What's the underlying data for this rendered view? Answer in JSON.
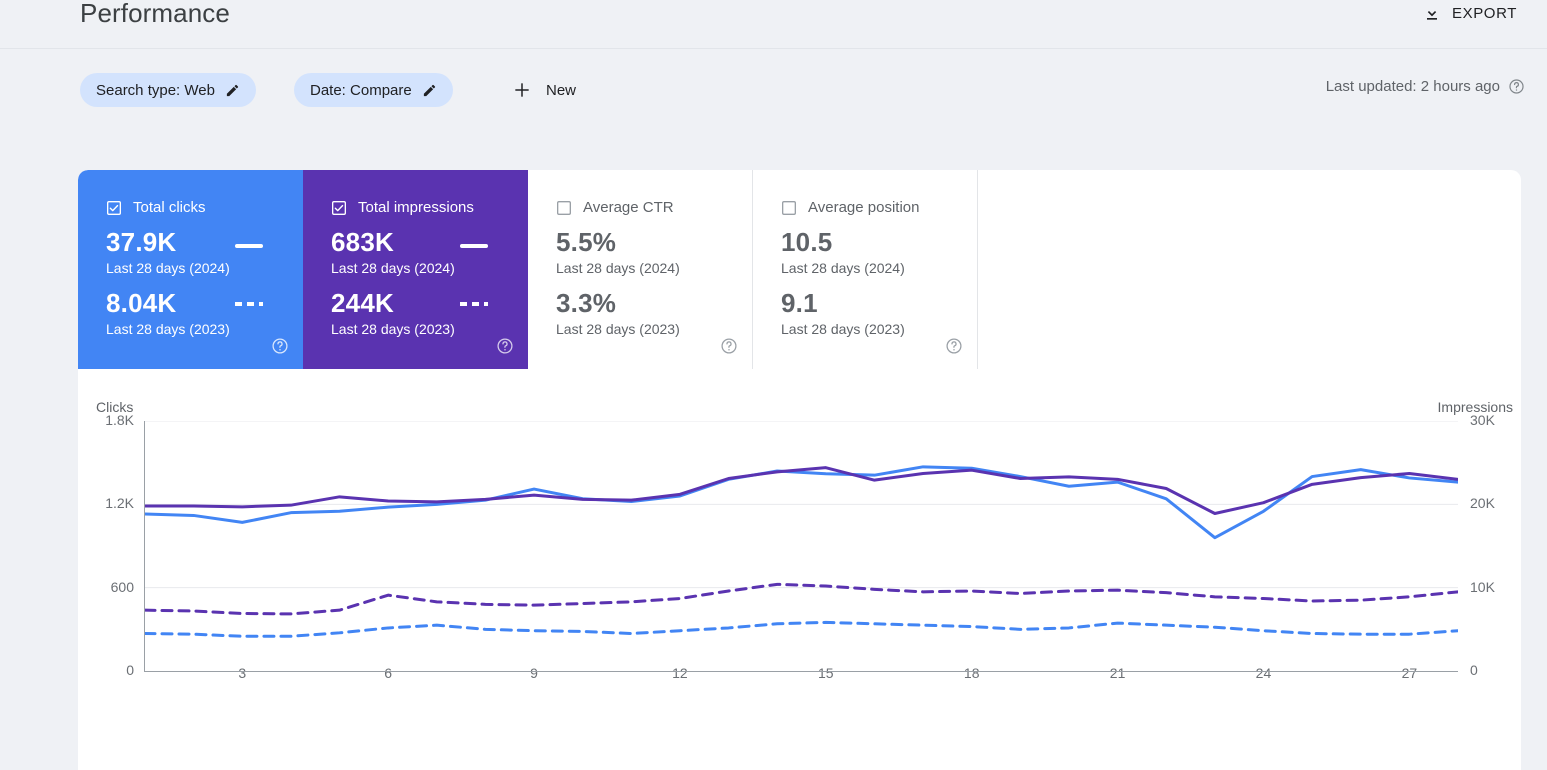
{
  "header": {
    "title": "Performance",
    "export_label": "EXPORT",
    "export_icon": "download-icon"
  },
  "filters": {
    "chips": [
      {
        "label": "Search type: Web",
        "edit_icon": "pencil-icon"
      },
      {
        "label": "Date: Compare",
        "edit_icon": "pencil-icon"
      }
    ],
    "new_label": "New",
    "new_icon": "plus-icon",
    "last_updated": "Last updated: 2 hours ago",
    "help_icon": "help-circle-icon"
  },
  "metrics": [
    {
      "label": "Total clicks",
      "checked": true,
      "state": "selected-blue",
      "color": "#4285f4",
      "current_value": "37.9K",
      "current_period": "Last 28 days (2024)",
      "compare_value": "8.04K",
      "compare_period": "Last 28 days (2023)",
      "help_icon": "help-circle-icon",
      "checkbox_icon": "checkbox-checked-icon"
    },
    {
      "label": "Total impressions",
      "checked": true,
      "state": "selected-purple",
      "color": "#5a33b0",
      "current_value": "683K",
      "current_period": "Last 28 days (2024)",
      "compare_value": "244K",
      "compare_period": "Last 28 days (2023)",
      "help_icon": "help-circle-icon",
      "checkbox_icon": "checkbox-checked-icon"
    },
    {
      "label": "Average CTR",
      "checked": false,
      "state": "unselected",
      "color": "#5f6368",
      "current_value": "5.5%",
      "current_period": "Last 28 days (2024)",
      "compare_value": "3.3%",
      "compare_period": "Last 28 days (2023)",
      "help_icon": "help-circle-icon",
      "checkbox_icon": "checkbox-unchecked-icon"
    },
    {
      "label": "Average position",
      "checked": false,
      "state": "unselected",
      "color": "#5f6368",
      "current_value": "10.5",
      "current_period": "Last 28 days (2024)",
      "compare_value": "9.1",
      "compare_period": "Last 28 days (2023)",
      "help_icon": "help-circle-icon",
      "checkbox_icon": "checkbox-unchecked-icon"
    }
  ],
  "chart_data": {
    "type": "line",
    "title": "",
    "xlabel": "",
    "ylabel": "Clicks",
    "y2label": "Impressions",
    "grid": true,
    "legend_position": "metric-tiles",
    "x": [
      1,
      2,
      3,
      4,
      5,
      6,
      7,
      8,
      9,
      10,
      11,
      12,
      13,
      14,
      15,
      16,
      17,
      18,
      19,
      20,
      21,
      22,
      23,
      24,
      25,
      26,
      27,
      28
    ],
    "xtick_labels": [
      "3",
      "6",
      "9",
      "12",
      "15",
      "18",
      "21",
      "24",
      "27"
    ],
    "xtick_positions": [
      3,
      6,
      9,
      12,
      15,
      18,
      21,
      24,
      27
    ],
    "ylim": [
      0,
      1800
    ],
    "ytick_labels": [
      "0",
      "600",
      "1.2K",
      "1.8K"
    ],
    "ytick_values": [
      0,
      600,
      1200,
      1800
    ],
    "y2lim": [
      0,
      30000
    ],
    "y2tick_labels": [
      "0",
      "10K",
      "20K",
      "30K"
    ],
    "y2tick_values": [
      0,
      10000,
      20000,
      30000
    ],
    "series": [
      {
        "name": "Total clicks — Last 28 days (2024)",
        "axis": "left",
        "style": "solid",
        "color": "#4285f4",
        "values": [
          1130,
          1120,
          1070,
          1140,
          1150,
          1180,
          1200,
          1230,
          1310,
          1240,
          1220,
          1260,
          1380,
          1440,
          1420,
          1410,
          1470,
          1460,
          1400,
          1330,
          1360,
          1240,
          960,
          1150,
          1400,
          1450,
          1390,
          1360
        ]
      },
      {
        "name": "Total impressions — Last 28 days (2024)",
        "axis": "right",
        "style": "solid",
        "color": "#5a33b0",
        "values": [
          19800,
          19800,
          19700,
          19900,
          20900,
          20400,
          20300,
          20600,
          21100,
          20600,
          20500,
          21200,
          23100,
          23900,
          24400,
          22900,
          23700,
          24100,
          23100,
          23300,
          23000,
          21900,
          18900,
          20200,
          22400,
          23200,
          23700,
          23000
        ]
      },
      {
        "name": "Total clicks — Last 28 days (2023)",
        "axis": "left",
        "style": "dashed",
        "color": "#4285f4",
        "values": [
          270,
          265,
          250,
          250,
          275,
          310,
          330,
          300,
          290,
          285,
          270,
          290,
          310,
          340,
          350,
          340,
          330,
          320,
          300,
          310,
          345,
          330,
          315,
          290,
          270,
          265,
          265,
          290
        ]
      },
      {
        "name": "Total impressions — Last 28 days (2023)",
        "axis": "right",
        "style": "dashed",
        "color": "#5a33b0",
        "values": [
          7300,
          7200,
          6900,
          6850,
          7300,
          9100,
          8300,
          8000,
          7900,
          8100,
          8300,
          8700,
          9600,
          10400,
          10200,
          9800,
          9500,
          9600,
          9300,
          9600,
          9700,
          9400,
          8900,
          8700,
          8400,
          8500,
          8900,
          9500
        ]
      }
    ]
  }
}
